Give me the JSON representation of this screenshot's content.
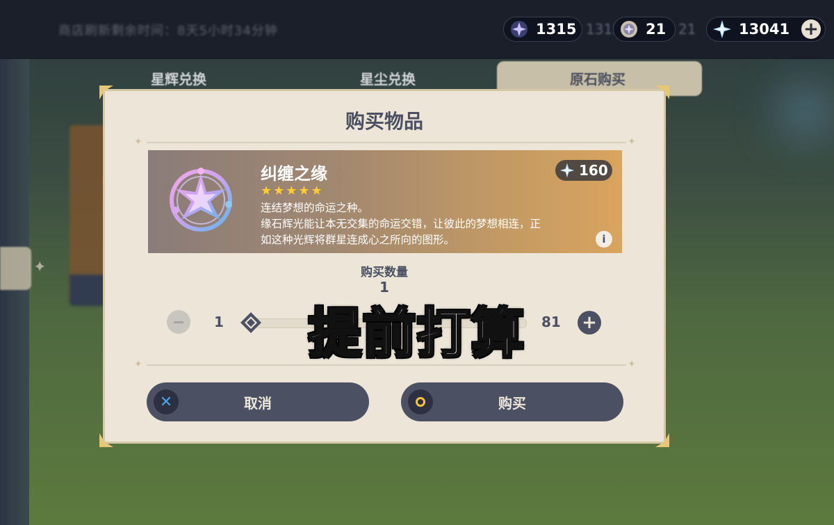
{
  "topbar": {
    "timer_text": "商店刷新剩余时间：8天5小时34分钟",
    "currencies": [
      {
        "icon": "starglitter-icon",
        "value": "1315",
        "ghost": "1315"
      },
      {
        "icon": "stardust-icon",
        "value": "21",
        "ghost": "21"
      },
      {
        "icon": "primogem-icon",
        "value": "13041"
      }
    ],
    "add_label": "+"
  },
  "tabs": [
    {
      "label": "星辉兑换",
      "active": false
    },
    {
      "label": "星尘兑换",
      "active": false
    },
    {
      "label": "原石购买",
      "active": true
    }
  ],
  "dialog": {
    "title": "购买物品",
    "item": {
      "name": "纠缠之缘",
      "stars": "★★★★★",
      "rarity": 5,
      "desc_line1": "连结梦想的命运之种。",
      "desc_line2": "缘石辉光能让本无交集的命运交错，让彼此的梦想相连，正",
      "desc_line3": "如这种光辉将群星连成心之所向的图形。",
      "price": "160",
      "price_icon": "primogem-icon",
      "info_label": "i"
    },
    "quantity": {
      "label": "购买数量",
      "value": "1",
      "min": "1",
      "max": "81",
      "minus_label": "−",
      "plus_label": "+"
    },
    "cancel_label": "取消",
    "confirm_label": "购买"
  },
  "overlay_caption": "提前打算",
  "colors": {
    "dialog_bg": "#ece5d8",
    "button_bg": "#4b5162",
    "star": "#ffcc32",
    "cancel_icon": "#4aa5e8",
    "confirm_icon": "#f5c542"
  }
}
